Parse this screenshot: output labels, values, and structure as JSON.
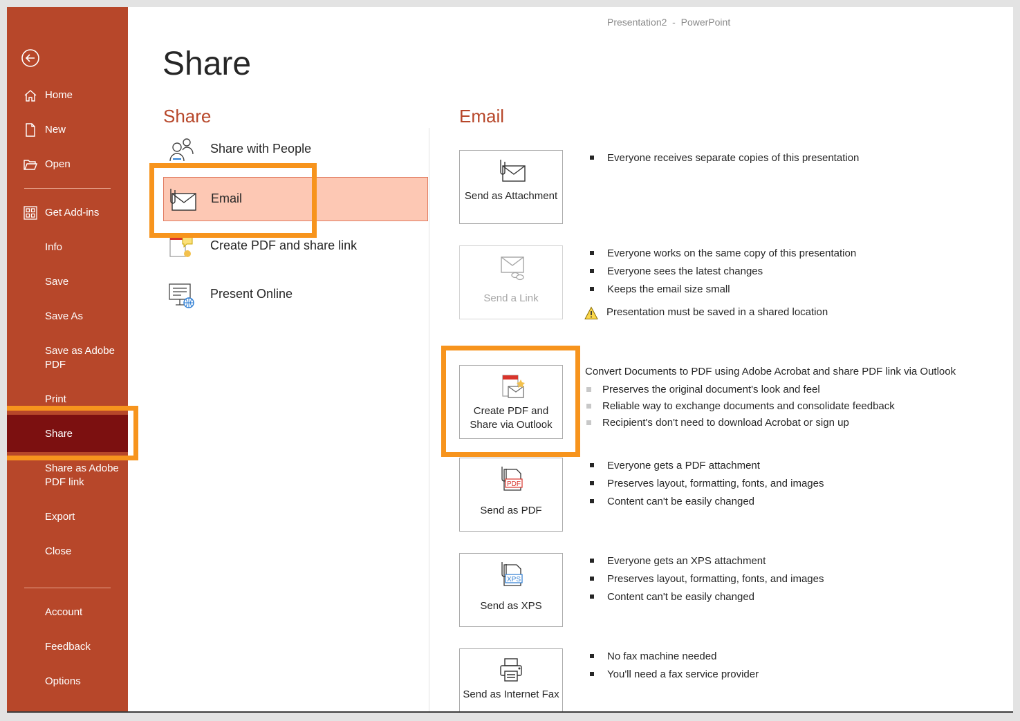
{
  "window": {
    "title": "Presentation2  -  PowerPoint"
  },
  "colors": {
    "sidebar": "#b7472a",
    "sidebar_selected": "#7c1010",
    "accent_heading": "#b7472a",
    "selected_option_bg": "#fdc8b4",
    "highlight_outline": "#f7941d"
  },
  "sidebar": {
    "back_icon": "back-arrow-icon",
    "items": [
      {
        "label": "Home",
        "icon": "home-icon"
      },
      {
        "label": "New",
        "icon": "new-document-icon"
      },
      {
        "label": "Open",
        "icon": "folder-open-icon"
      },
      {
        "label": "Get Add-ins",
        "icon": "grid-icon"
      },
      {
        "label": "Info"
      },
      {
        "label": "Save"
      },
      {
        "label": "Save As"
      },
      {
        "label": "Save as Adobe PDF"
      },
      {
        "label": "Print"
      },
      {
        "label": "Share",
        "selected": true
      },
      {
        "label": "Share as Adobe PDF link"
      },
      {
        "label": "Export"
      },
      {
        "label": "Close"
      },
      {
        "label": "Account"
      },
      {
        "label": "Feedback"
      },
      {
        "label": "Options"
      }
    ]
  },
  "main": {
    "heading": "Share",
    "share_section": {
      "heading": "Share",
      "options": [
        {
          "label": "Share with People",
          "icon": "people-icon"
        },
        {
          "label": "Email",
          "icon": "email-attachment-icon",
          "selected": true
        },
        {
          "label": "Create PDF and share link",
          "icon": "pdf-share-icon"
        },
        {
          "label": "Present Online",
          "icon": "present-online-icon"
        }
      ]
    },
    "email_section": {
      "heading": "Email",
      "actions": [
        {
          "label": "Send as Attachment",
          "icon": "email-attachment-icon",
          "bullets": [
            "Everyone receives separate copies of this presentation"
          ]
        },
        {
          "label": "Send a Link",
          "icon": "email-link-icon",
          "disabled": true,
          "bullets": [
            "Everyone works on the same copy of this presentation",
            "Everyone sees the latest changes",
            "Keeps the email size small"
          ],
          "warning": "Presentation must be saved in a shared location"
        },
        {
          "label": "Create PDF and Share via Outlook",
          "icon": "pdf-outlook-icon",
          "description": "Convert Documents to PDF using Adobe Acrobat and share PDF link via Outlook",
          "bullets": [
            "Preserves the original document's look and feel",
            "Reliable way to exchange documents and consolidate feedback",
            "Recipient's don't need to download Acrobat or sign up"
          ]
        },
        {
          "label": "Send as PDF",
          "icon": "pdf-attachment-icon",
          "icon_text": "PDF",
          "bullets": [
            "Everyone gets a PDF attachment",
            "Preserves layout, formatting, fonts, and images",
            "Content can't be easily changed"
          ]
        },
        {
          "label": "Send as XPS",
          "icon": "xps-attachment-icon",
          "icon_text": "XPS",
          "bullets": [
            "Everyone gets an XPS attachment",
            "Preserves layout, formatting, fonts, and images",
            "Content can't be easily changed"
          ]
        },
        {
          "label": "Send as Internet Fax",
          "icon": "fax-icon",
          "bullets": [
            "No fax machine needed",
            "You'll need a fax service provider"
          ]
        }
      ]
    }
  }
}
